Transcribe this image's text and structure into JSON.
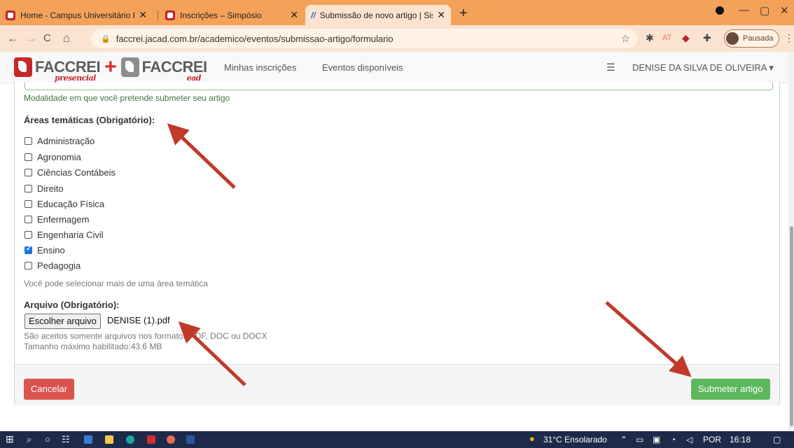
{
  "browser": {
    "tabs": [
      {
        "title": "Home - Campus Universitário FA",
        "close": "✕"
      },
      {
        "title": "Inscrições – Simpósio",
        "close": "✕"
      },
      {
        "title": "Submissão de novo artigo | Siste",
        "close": "✕"
      }
    ],
    "new_tab": "+",
    "url": "faccrei.jacad.com.br/academico/eventos/submissao-artigo/formulario",
    "ext_text": "AT",
    "profile_label": "Pausada",
    "window": {
      "minimize": "—",
      "maximize": "▢",
      "close": "✕"
    },
    "nav": {
      "back": "←",
      "forward": "→",
      "reload": "C",
      "home": "⌂"
    }
  },
  "header": {
    "brand1": "FACCREI",
    "brand1_sub": "presencial",
    "plus": "+",
    "brand2": "FACCREI",
    "brand2_sub": "ead",
    "nav": [
      "Minhas inscrições",
      "Eventos disponíveis"
    ],
    "user": "DENISE DA SILVA DE OLIVEIRA ▾"
  },
  "form": {
    "modalidade_help": "Modalidade em que você pretende submeter seu artigo",
    "areas_label": "Áreas temáticas (Obrigatório):",
    "areas": [
      {
        "label": "Administração",
        "checked": false
      },
      {
        "label": "Agronomia",
        "checked": false
      },
      {
        "label": "Ciências Contábeis",
        "checked": false
      },
      {
        "label": "Direito",
        "checked": false
      },
      {
        "label": "Educação Física",
        "checked": false
      },
      {
        "label": "Enfermagem",
        "checked": false
      },
      {
        "label": "Engenharia Civil",
        "checked": false
      },
      {
        "label": "Ensino",
        "checked": true
      },
      {
        "label": "Pedagogia",
        "checked": false
      }
    ],
    "areas_help": "Você pode selecionar mais de uma área temática",
    "file_label": "Arquivo (Obrigatório):",
    "file_button": "Escolher arquivo",
    "file_name": "DENISE (1).pdf",
    "file_help_1": "São aceitos somente arquivos nos formatos PDF, DOC ou DOCX",
    "file_help_2": "Tamanho máximo habilitado:43.6 MB",
    "cancel": "Cancelar",
    "submit": "Submeter artigo"
  },
  "taskbar": {
    "weather": "31°C  Ensolarado",
    "lang": "POR",
    "time": "16:18"
  },
  "colors": {
    "accent_red": "#d9534f",
    "accent_green": "#5cb85c",
    "tab_strip": "#f4a259",
    "annotation_arrow": "#c0392b"
  }
}
